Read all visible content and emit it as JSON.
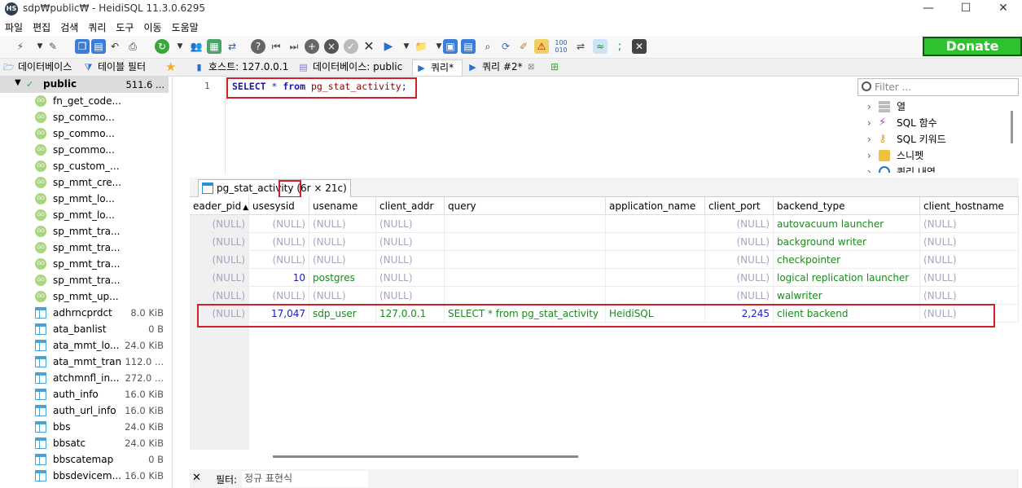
{
  "window": {
    "title": "sdp₩public₩ - HeidiSQL 11.3.0.6295",
    "app_icon": "HS"
  },
  "menu": [
    "파일",
    "편집",
    "검색",
    "쿼리",
    "도구",
    "이동",
    "도움말"
  ],
  "donate_label": "Donate",
  "tabs": {
    "db_tab": "데이터베이스",
    "table_filter": "테이블 필터",
    "host": "호스트: 127.0.0.1",
    "database": "데이터베이스: public",
    "query": "쿼리*",
    "query2": "쿼리 #2*"
  },
  "tree": {
    "root": {
      "name": "public",
      "size": "511.6 ..."
    },
    "items": [
      {
        "name": "fn_get_code...",
        "size": "",
        "kind": "function"
      },
      {
        "name": "sp_commo...",
        "size": "",
        "kind": "function"
      },
      {
        "name": "sp_commo...",
        "size": "",
        "kind": "function"
      },
      {
        "name": "sp_commo...",
        "size": "",
        "kind": "function"
      },
      {
        "name": "sp_custom_...",
        "size": "",
        "kind": "function"
      },
      {
        "name": "sp_mmt_cre...",
        "size": "",
        "kind": "function"
      },
      {
        "name": "sp_mmt_lo...",
        "size": "",
        "kind": "function"
      },
      {
        "name": "sp_mmt_lo...",
        "size": "",
        "kind": "function"
      },
      {
        "name": "sp_mmt_tra...",
        "size": "",
        "kind": "function"
      },
      {
        "name": "sp_mmt_tra...",
        "size": "",
        "kind": "function"
      },
      {
        "name": "sp_mmt_tra...",
        "size": "",
        "kind": "function"
      },
      {
        "name": "sp_mmt_tra...",
        "size": "",
        "kind": "function"
      },
      {
        "name": "sp_mmt_up...",
        "size": "",
        "kind": "function"
      },
      {
        "name": "adhrncprdct",
        "size": "8.0 KiB",
        "kind": "table"
      },
      {
        "name": "ata_banlist",
        "size": "0 B",
        "kind": "table"
      },
      {
        "name": "ata_mmt_lo...",
        "size": "24.0 KiB",
        "kind": "table"
      },
      {
        "name": "ata_mmt_tran",
        "size": "112.0 ...",
        "kind": "table"
      },
      {
        "name": "atchmnfl_in...",
        "size": "272.0 ...",
        "kind": "table"
      },
      {
        "name": "auth_info",
        "size": "16.0 KiB",
        "kind": "table"
      },
      {
        "name": "auth_url_info",
        "size": "16.0 KiB",
        "kind": "table"
      },
      {
        "name": "bbs",
        "size": "24.0 KiB",
        "kind": "table"
      },
      {
        "name": "bbsatc",
        "size": "24.0 KiB",
        "kind": "table"
      },
      {
        "name": "bbscatemap",
        "size": "0 B",
        "kind": "table"
      },
      {
        "name": "bbsdevicem...",
        "size": "16.0 KiB",
        "kind": "table"
      }
    ]
  },
  "editor": {
    "line_number": "1",
    "sql_select": "SELECT",
    "sql_star": " * ",
    "sql_from": "from",
    "sql_table": " pg_stat_activity",
    "sql_end": ";"
  },
  "helper_panel": {
    "filter_placeholder": "Filter ...",
    "items": [
      "열",
      "SQL 함수",
      "SQL 키워드",
      "스니펫",
      "쿼리 내역"
    ]
  },
  "result_tab": {
    "name": "pg_stat_activity",
    "count": "(6r × 21c)"
  },
  "grid": {
    "columns": [
      "eader_pid",
      "usesysid",
      "usename",
      "client_addr",
      "query",
      "application_name",
      "client_port",
      "backend_type",
      "client_hostname"
    ],
    "rows": [
      [
        "(NULL)",
        "(NULL)",
        "(NULL)",
        "(NULL)",
        "",
        "",
        "(NULL)",
        "autovacuum launcher",
        "(NULL)"
      ],
      [
        "(NULL)",
        "(NULL)",
        "(NULL)",
        "(NULL)",
        "",
        "",
        "(NULL)",
        "background writer",
        "(NULL)"
      ],
      [
        "(NULL)",
        "(NULL)",
        "(NULL)",
        "(NULL)",
        "",
        "",
        "(NULL)",
        "checkpointer",
        "(NULL)"
      ],
      [
        "(NULL)",
        "10",
        "postgres",
        "(NULL)",
        "",
        "",
        "(NULL)",
        "logical replication launcher",
        "(NULL)"
      ],
      [
        "(NULL)",
        "(NULL)",
        "(NULL)",
        "(NULL)",
        "",
        "",
        "(NULL)",
        "walwriter",
        "(NULL)"
      ],
      [
        "(NULL)",
        "17,047",
        "sdp_user",
        "127.0.0.1",
        "SELECT * from pg_stat_activity",
        "HeidiSQL",
        "2,245",
        "client backend",
        "(NULL)"
      ]
    ]
  },
  "filterbar": {
    "label": "필터:",
    "placeholder": "정규 표현식"
  },
  "colors": {
    "highlight": "#d0202a",
    "donate": "#2fc12f",
    "null": "#a3a7bd",
    "text_value": "#1a8a1a",
    "num_value": "#1a1acf"
  }
}
